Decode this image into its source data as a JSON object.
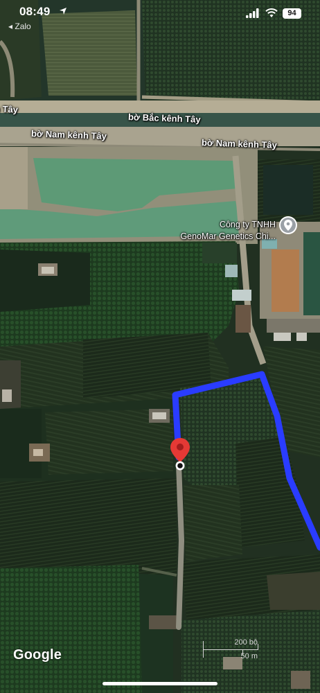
{
  "status_bar": {
    "time": "08:49",
    "back_app": "◂ Zalo",
    "battery": "94",
    "icons": [
      "location-arrow-icon",
      "cellular-signal-icon",
      "wifi-icon",
      "battery-icon"
    ]
  },
  "map": {
    "map_type": "satellite",
    "roads": [
      {
        "label": "bờ Bắc kênh Tây"
      },
      {
        "label": "bờ Nam kênh Tây"
      },
      {
        "label": "bờ Nam kênh Tây"
      },
      {
        "label": "h Tây"
      }
    ],
    "poi": {
      "name_line1": "Công ty TNHH",
      "name_line2": "GenoMar Genetics Chi...",
      "icon": "place-pin-icon"
    },
    "route_color": "#2a3cff",
    "destination_marker_color": "#e53935"
  },
  "attribution": "Google",
  "scale_bar": {
    "top_label": "200 bộ",
    "bottom_label": "50 m"
  }
}
